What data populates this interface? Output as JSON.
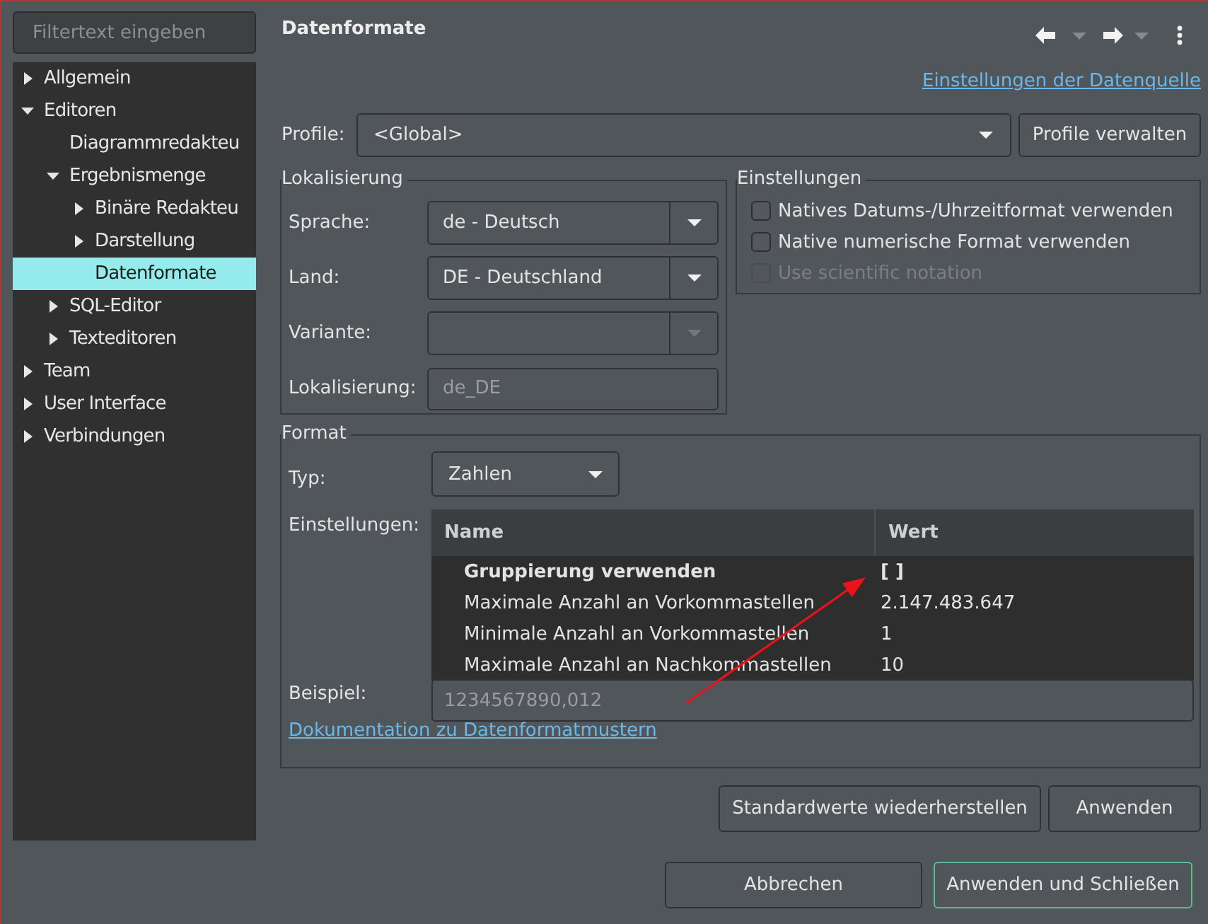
{
  "sidebar": {
    "filter": {
      "placeholder": "Filtertext eingeben"
    },
    "tree": [
      {
        "label": "Allgemein",
        "expanded": false,
        "selected": false
      },
      {
        "label": "Editoren",
        "expanded": true,
        "selected": false,
        "children": [
          {
            "label": "Diagrammredakteu",
            "selected": false
          },
          {
            "label": "Ergebnismenge",
            "expanded": true,
            "selected": false,
            "children": [
              {
                "label": "Binäre Redakteu",
                "expanded": false,
                "selected": false
              },
              {
                "label": "Darstellung",
                "expanded": false,
                "selected": false
              },
              {
                "label": "Datenformate",
                "selected": true
              }
            ]
          },
          {
            "label": "SQL-Editor",
            "expanded": false,
            "selected": false
          },
          {
            "label": "Texteditoren",
            "expanded": false,
            "selected": false
          }
        ]
      },
      {
        "label": "Team",
        "expanded": false,
        "selected": false
      },
      {
        "label": "User Interface",
        "expanded": false,
        "selected": false
      },
      {
        "label": "Verbindungen",
        "expanded": false,
        "selected": false
      }
    ]
  },
  "header": {
    "title": "Datenformate",
    "datasource_link": "Einstellungen der Datenquelle"
  },
  "profile": {
    "label": "Profile:",
    "value": "<Global>",
    "button": "Profile verwalten"
  },
  "localization": {
    "title": "Lokalisierung",
    "fields": [
      {
        "label": "Sprache:",
        "kind": "combo",
        "value": "de - Deutsch",
        "disabled": false
      },
      {
        "label": "Land:",
        "kind": "combo",
        "value": "DE - Deutschland",
        "disabled": false
      },
      {
        "label": "Variante:",
        "kind": "combo",
        "disabled": true
      },
      {
        "label": "Lokalisierung:",
        "kind": "text",
        "value": "de_DE",
        "disabled": true
      }
    ]
  },
  "settings": {
    "title": "Einstellungen",
    "checkboxes": [
      {
        "label": "Natives Datums-/Uhrzeitformat verwenden",
        "checked": false,
        "disabled": false
      },
      {
        "label": "Native numerische Format verwenden",
        "checked": false,
        "disabled": false
      },
      {
        "label": "Use scientific notation",
        "checked": false,
        "disabled": true
      }
    ]
  },
  "format": {
    "title": "Format",
    "type": {
      "label": "Typ:",
      "value": "Zahlen"
    },
    "settings_label": "Einstellungen:",
    "table": {
      "columns": [
        "Name",
        "Wert"
      ],
      "rows": [
        {
          "name": "Gruppierung verwenden",
          "value": "[ ]",
          "modified": true
        },
        {
          "name": "Maximale Anzahl an Vorkommastellen",
          "value": "2.147.483.647",
          "modified": false
        },
        {
          "name": "Minimale Anzahl an Vorkommastellen",
          "value": "1",
          "modified": false
        },
        {
          "name": "Maximale Anzahl an Nachkommastellen",
          "value": "10",
          "modified": false
        }
      ]
    },
    "example": {
      "label": "Beispiel:",
      "value": "1234567890,012",
      "disabled": true
    },
    "doc_link": "Dokumentation zu Datenformatmustern"
  },
  "actions": [
    "Standardwerte wiederherstellen",
    "Anwenden"
  ],
  "dialog_buttons": [
    {
      "label": "Abbrechen",
      "default": false
    },
    {
      "label": "Anwenden und Schließen",
      "default": true
    }
  ]
}
